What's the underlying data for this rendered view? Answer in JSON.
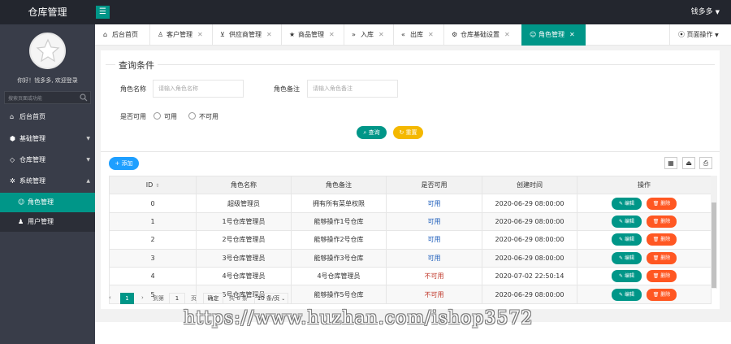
{
  "app": {
    "title": "仓库管理",
    "user_name": "钱多多"
  },
  "sidebar": {
    "welcome": "你好！钱多多, 欢迎登录",
    "search_placeholder": "搜索页面或功能",
    "items": [
      {
        "label": "后台首页",
        "icon": "home-icon"
      },
      {
        "label": "基础管理",
        "icon": "box-icon"
      },
      {
        "label": "仓库管理",
        "icon": "diamond-icon"
      },
      {
        "label": "系统管理",
        "icon": "gear-icon"
      },
      {
        "label": "角色管理",
        "icon": "smile-icon",
        "active": true
      },
      {
        "label": "用户管理",
        "icon": "user-icon"
      }
    ]
  },
  "tabs": [
    {
      "label": "后台首页",
      "icon": "home-icon"
    },
    {
      "label": "客户管理",
      "icon": "user-icon"
    },
    {
      "label": "供应商管理",
      "icon": "cart-icon"
    },
    {
      "label": "商品管理",
      "icon": "star-icon"
    },
    {
      "label": "入库",
      "icon": "double-right-icon"
    },
    {
      "label": "出库",
      "icon": "double-left-icon"
    },
    {
      "label": "仓库基础设置",
      "icon": "gear-icon"
    },
    {
      "label": "角色管理",
      "icon": "smile-icon",
      "active": true
    }
  ],
  "page_ops_label": "页面操作",
  "query": {
    "title": "查询条件",
    "role_name_label": "角色名称",
    "role_name_placeholder": "请输入角色名称",
    "role_remark_label": "角色备注",
    "role_remark_placeholder": "请输入角色备注",
    "enabled_label": "是否可用",
    "options": [
      "可用",
      "不可用"
    ],
    "search_btn": "查询",
    "reset_btn": "重置"
  },
  "toolbar": {
    "add_btn": "添加"
  },
  "table": {
    "columns": [
      "ID",
      "角色名称",
      "角色备注",
      "是否可用",
      "创建时间",
      "操作"
    ],
    "edit_label": "编辑",
    "delete_label": "删除",
    "rows": [
      {
        "id": "0",
        "name": "超级管理员",
        "remark": "拥有所有菜单权限",
        "enabled": "可用",
        "created": "2020-06-29 08:00:00"
      },
      {
        "id": "1",
        "name": "1号仓库管理员",
        "remark": "能够操作1号仓库",
        "enabled": "可用",
        "created": "2020-06-29 08:00:00"
      },
      {
        "id": "2",
        "name": "2号仓库管理员",
        "remark": "能够操作2号仓库",
        "enabled": "可用",
        "created": "2020-06-29 08:00:00"
      },
      {
        "id": "3",
        "name": "3号仓库管理员",
        "remark": "能够操作3号仓库",
        "enabled": "可用",
        "created": "2020-06-29 08:00:00"
      },
      {
        "id": "4",
        "name": "4号仓库管理员",
        "remark": "4号仓库管理员",
        "enabled": "不可用",
        "created": "2020-07-02 22:50:14"
      },
      {
        "id": "5",
        "name": "5号仓库管理员",
        "remark": "能够操作5号仓库",
        "enabled": "不可用",
        "created": "2020-06-29 08:00:00"
      }
    ]
  },
  "pager": {
    "prev": "‹",
    "current": "1",
    "next": "›",
    "goto_label": "到第",
    "goto_value": "1",
    "page_unit": "页",
    "confirm": "确定",
    "total": "共 6 条",
    "page_size": "10 条/页"
  },
  "watermark": "https://www.huzhan.com/ishop3572",
  "colors": {
    "primary": "#009688",
    "warning": "#f4b800",
    "danger": "#ff5722",
    "info": "#1e9fff",
    "dark": "#23262e",
    "side": "#393d49"
  }
}
